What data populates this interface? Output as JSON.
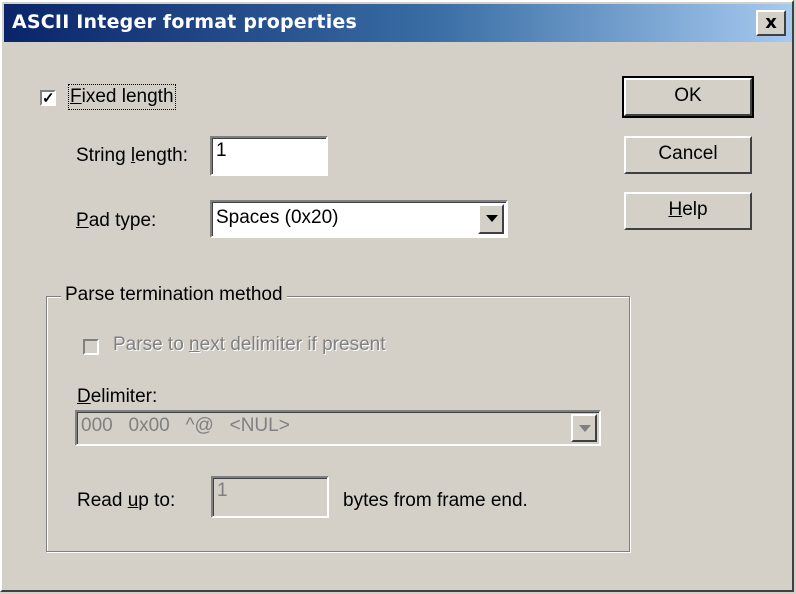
{
  "window": {
    "title": "ASCII Integer format properties",
    "close_glyph": "x"
  },
  "fixed_length": {
    "checked": true,
    "check_glyph": "✓",
    "label_ul": "F",
    "label_rest": "ixed length"
  },
  "string_length": {
    "label_pre": "String ",
    "label_ul": "l",
    "label_post": "ength:",
    "value": "1"
  },
  "pad_type": {
    "label_ul": "P",
    "label_rest": "ad type:",
    "value": "Spaces (0x20)"
  },
  "parse_group": {
    "title": "Parse termination method",
    "parse_next": {
      "checked": false,
      "label_pre": "Parse to ",
      "label_ul": "n",
      "label_post": "ext delimiter if present"
    },
    "delimiter": {
      "label_ul": "D",
      "label_rest": "elimiter:",
      "value": "000   0x00   ^@   <NUL>"
    },
    "read_up_to": {
      "label_pre": "Read ",
      "label_ul": "u",
      "label_post": "p to:",
      "value": "1",
      "suffix": "bytes from frame end."
    }
  },
  "buttons": {
    "ok": "OK",
    "cancel": "Cancel",
    "help_ul": "H",
    "help_rest": "elp"
  }
}
